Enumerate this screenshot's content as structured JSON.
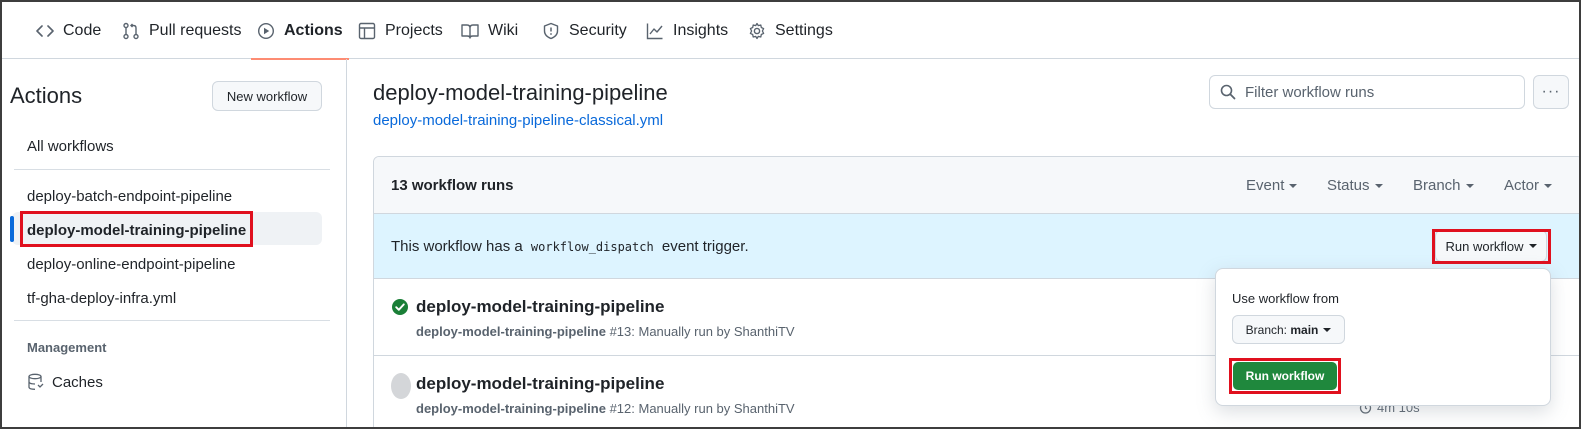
{
  "nav": {
    "tabs": [
      {
        "label": "Code",
        "icon": "code-icon"
      },
      {
        "label": "Pull requests",
        "icon": "pull-request-icon"
      },
      {
        "label": "Actions",
        "icon": "play-icon"
      },
      {
        "label": "Projects",
        "icon": "table-icon"
      },
      {
        "label": "Wiki",
        "icon": "book-icon"
      },
      {
        "label": "Security",
        "icon": "shield-icon"
      },
      {
        "label": "Insights",
        "icon": "graph-icon"
      },
      {
        "label": "Settings",
        "icon": "gear-icon"
      }
    ],
    "active": "Actions",
    "accent_color": "#fd8c73"
  },
  "sidebar": {
    "title": "Actions",
    "new_workflow_label": "New workflow",
    "all_workflows_label": "All workflows",
    "workflows": [
      "deploy-batch-endpoint-pipeline",
      "deploy-model-training-pipeline",
      "deploy-online-endpoint-pipeline",
      "tf-gha-deploy-infra.yml"
    ],
    "selected_workflow": "deploy-model-training-pipeline",
    "management_label": "Management",
    "caches_label": "Caches"
  },
  "main": {
    "title": "deploy-model-training-pipeline",
    "file_link": "deploy-model-training-pipeline-classical.yml",
    "filter_placeholder": "Filter workflow runs",
    "more_label": "···",
    "runs_count": "13 workflow runs",
    "filters": [
      "Event",
      "Status",
      "Branch",
      "Actor"
    ],
    "dispatch": {
      "prefix": "This workflow has a",
      "code": "workflow_dispatch",
      "suffix": "event trigger.",
      "button_label": "Run workflow"
    },
    "runs": [
      {
        "title": "deploy-model-training-pipeline",
        "workflow": "deploy-model-training-pipeline",
        "detail": "#13: Manually run by ShanthiTV",
        "status": "success"
      },
      {
        "title": "deploy-model-training-pipeline",
        "workflow": "deploy-model-training-pipeline",
        "detail": "#12: Manually run by ShanthiTV",
        "status": "in-progress",
        "duration": "4m 10s"
      }
    ]
  },
  "popover": {
    "label": "Use workflow from",
    "branch_prefix": "Branch:",
    "branch_value": "main",
    "run_button_label": "Run workflow"
  },
  "colors": {
    "link": "#0969da",
    "success": "#1a7f37",
    "primary_button": "#1f883d",
    "highlight": "#e0101e",
    "dispatch_bg": "#ddf4ff"
  }
}
